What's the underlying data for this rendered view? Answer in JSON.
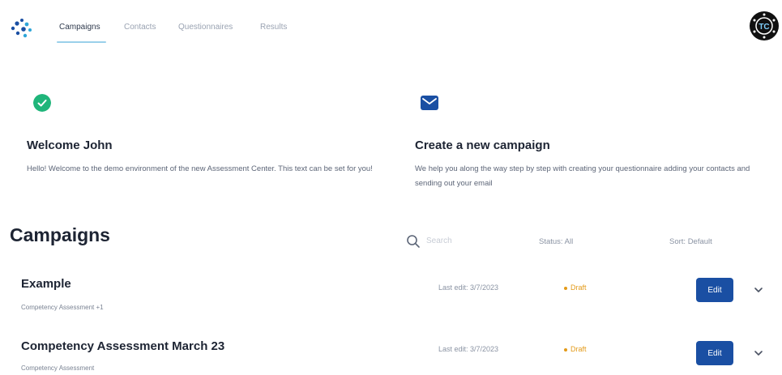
{
  "nav": {
    "tabs": [
      {
        "label": "Campaigns",
        "active": true
      },
      {
        "label": "Contacts",
        "active": false
      },
      {
        "label": "Questionnaires",
        "active": false
      },
      {
        "label": "Results",
        "active": false
      }
    ],
    "logo_icon": "dots-logo-icon",
    "avatar_text": "TC"
  },
  "cards": {
    "welcome": {
      "icon": "check-circle-icon",
      "title": "Welcome John",
      "text": "Hello! Welcome to the demo environment of the new Assessment Center. This text can be set for you!"
    },
    "create": {
      "icon": "mail-icon",
      "title": "Create a new campaign",
      "text": "We help you along the way step by step with creating your questionnaire adding your contacts and sending out your email"
    }
  },
  "campaigns": {
    "title": "Campaigns",
    "search": {
      "value": "",
      "placeholder": "Search"
    },
    "status_filter": "Status: All",
    "sort": "Sort: Default",
    "rows": [
      {
        "title": "Example",
        "subtitle": "Competency Assessment +1",
        "last_edit": "Last edit: 3/7/2023",
        "status": "Draft",
        "edit_label": "Edit"
      },
      {
        "title": "Competency Assessment March 23",
        "subtitle": "Competency Assessment",
        "last_edit": "Last edit: 3/7/2023",
        "status": "Draft",
        "edit_label": "Edit"
      }
    ]
  },
  "colors": {
    "accent": "#1a4fa3",
    "success": "#1fb57a",
    "draft": "#e39a18",
    "nav_underline": "#9ad0ea"
  }
}
